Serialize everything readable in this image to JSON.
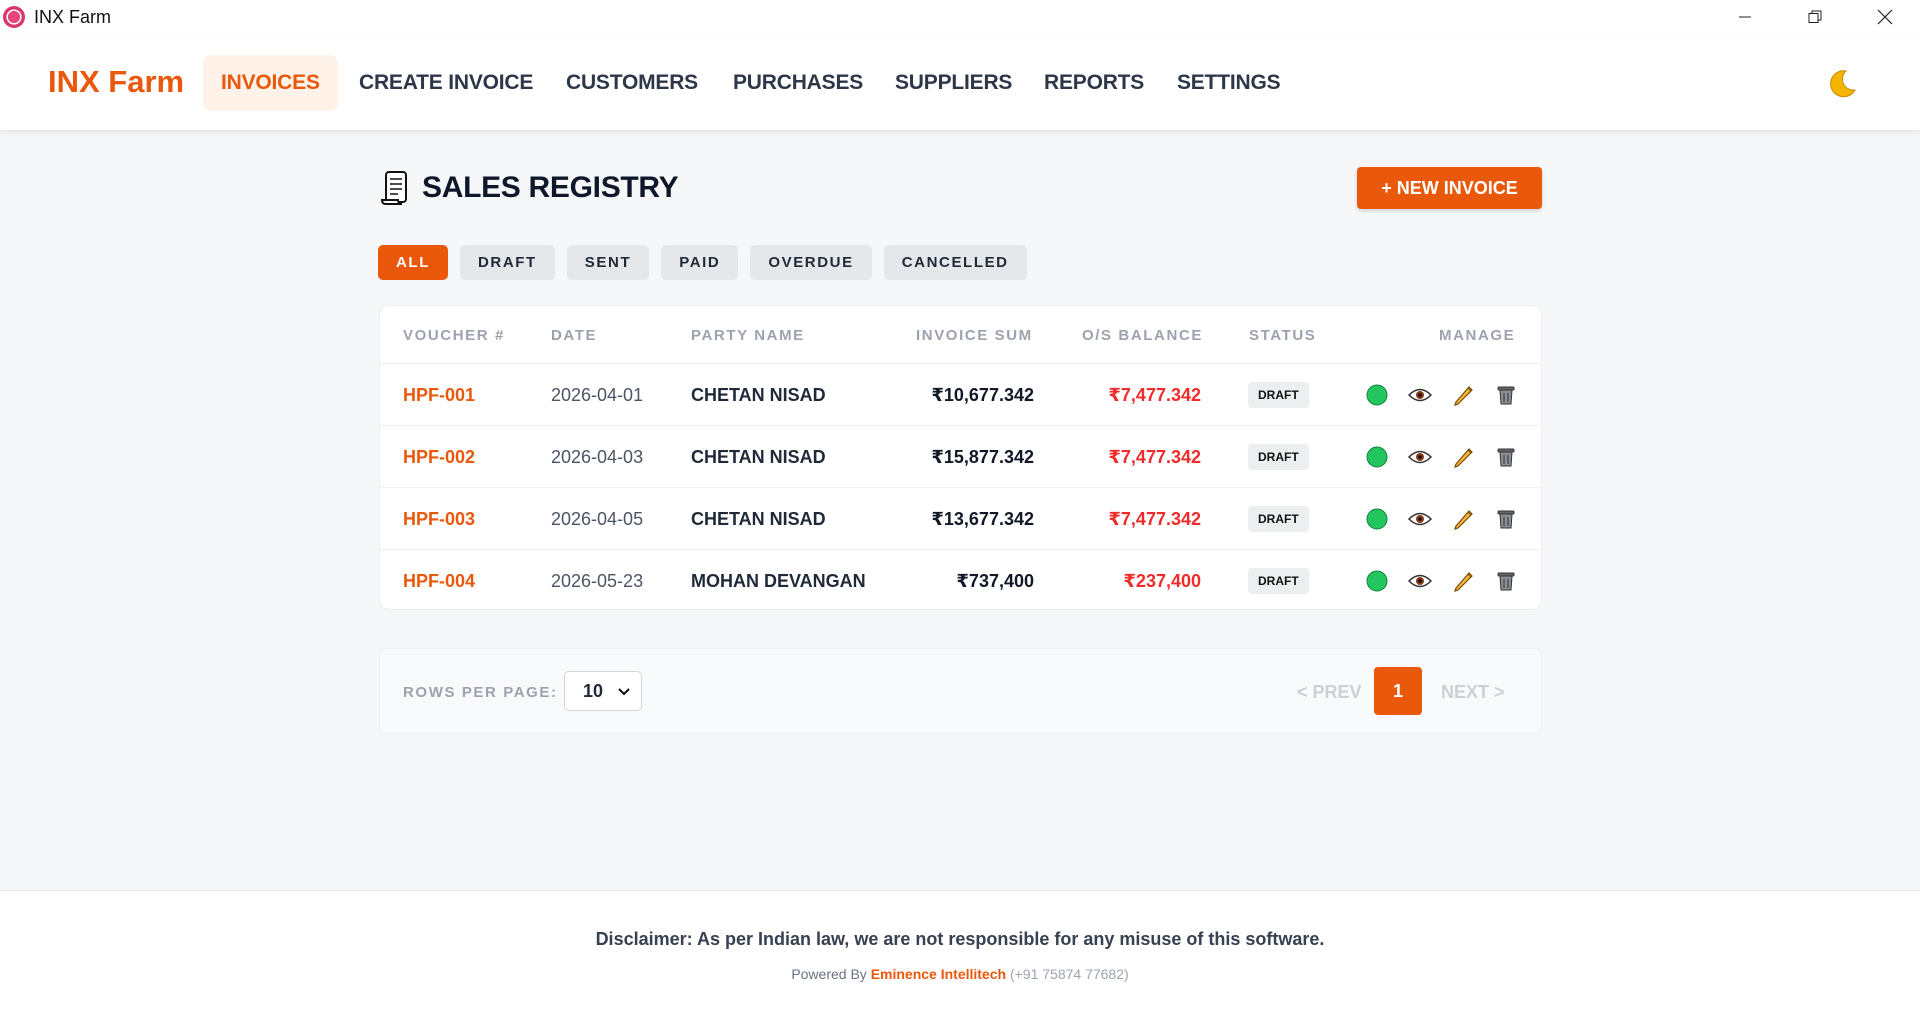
{
  "window": {
    "title": "INX Farm"
  },
  "nav": {
    "brand": "INX Farm",
    "items": [
      "INVOICES",
      "CREATE INVOICE",
      "CUSTOMERS",
      "PURCHASES",
      "SUPPLIERS",
      "REPORTS",
      "SETTINGS"
    ],
    "active": "INVOICES",
    "theme_icon": "moon-icon"
  },
  "page": {
    "title": "SALES REGISTRY",
    "new_button": "+ NEW INVOICE",
    "filters": [
      "ALL",
      "DRAFT",
      "SENT",
      "PAID",
      "OVERDUE",
      "CANCELLED"
    ],
    "active_filter": "ALL"
  },
  "table": {
    "headers": {
      "voucher": "VOUCHER #",
      "date": "DATE",
      "party": "PARTY NAME",
      "sum": "INVOICE SUM",
      "balance": "O/S BALANCE",
      "status": "STATUS",
      "manage": "MANAGE"
    },
    "rows": [
      {
        "voucher": "HPF-001",
        "date": "2026-04-01",
        "party": "CHETAN NISAD",
        "sum": "₹10,677.342",
        "balance": "₹7,477.342",
        "status": "DRAFT"
      },
      {
        "voucher": "HPF-002",
        "date": "2026-04-03",
        "party": "CHETAN NISAD",
        "sum": "₹15,877.342",
        "balance": "₹7,477.342",
        "status": "DRAFT"
      },
      {
        "voucher": "HPF-003",
        "date": "2026-04-05",
        "party": "CHETAN NISAD",
        "sum": "₹13,677.342",
        "balance": "₹7,477.342",
        "status": "DRAFT"
      },
      {
        "voucher": "HPF-004",
        "date": "2026-05-23",
        "party": "MOHAN DEVANGAN",
        "sum": "₹737,400",
        "balance": "₹237,400",
        "status": "DRAFT"
      }
    ]
  },
  "pagination": {
    "rows_label": "ROWS PER PAGE:",
    "rows_value": "10",
    "prev": "< PREV",
    "current": "1",
    "next": "NEXT >"
  },
  "footer": {
    "disclaimer": "Disclaimer: As per Indian law, we are not responsible for any misuse of this software.",
    "powered_prefix": "Powered By",
    "company": "Eminence Intellitech",
    "phone": "(+91 75874 77682)"
  },
  "colors": {
    "accent": "#ea580c",
    "balance": "#ef2b2b",
    "status_dot": "#22c55e"
  }
}
